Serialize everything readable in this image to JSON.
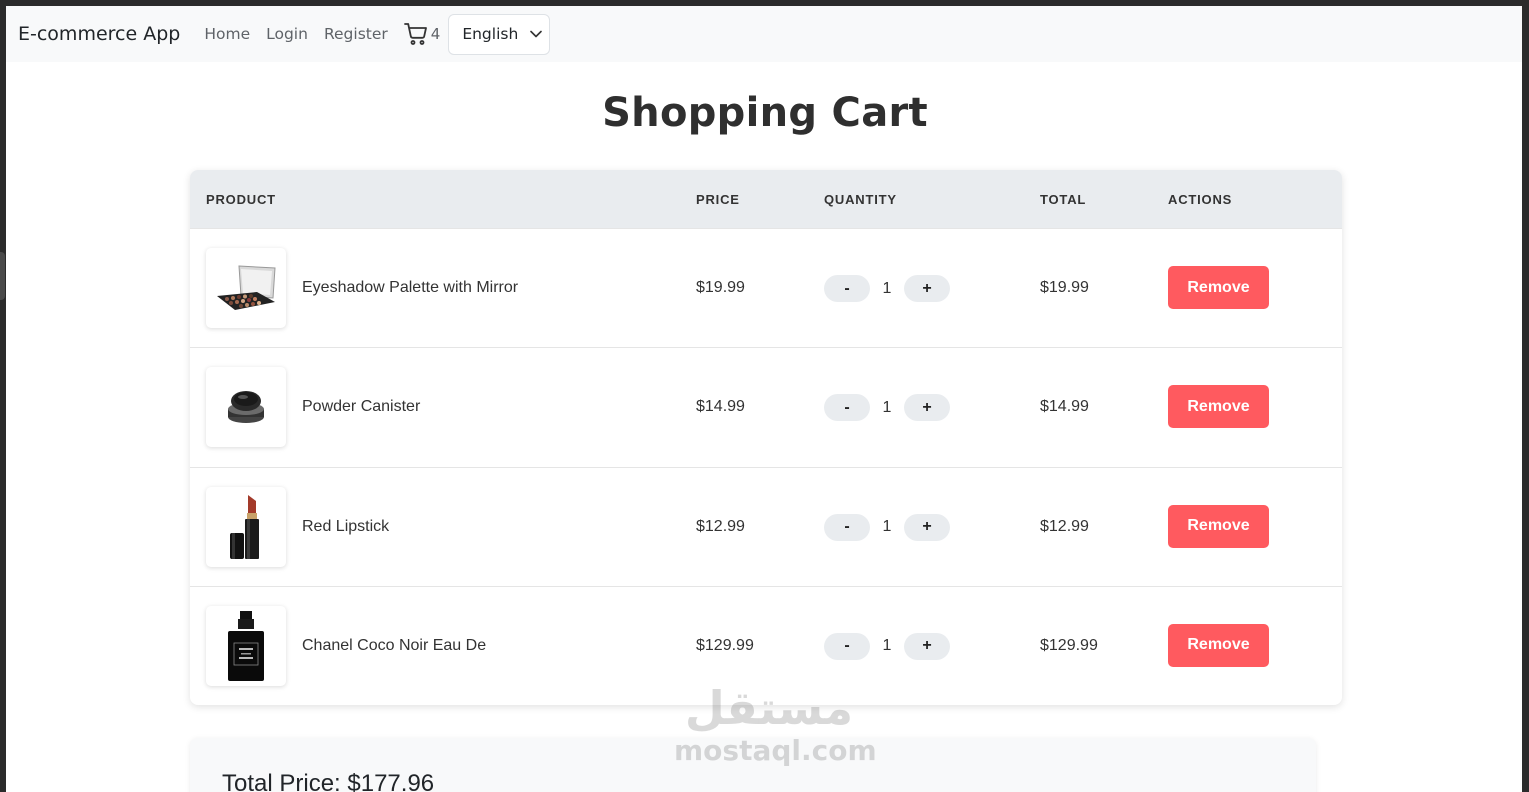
{
  "navbar": {
    "brand": "E-commerce App",
    "links": [
      "Home",
      "Login",
      "Register"
    ],
    "cart_count": "4",
    "language": "English"
  },
  "page": {
    "title": "Shopping Cart"
  },
  "table": {
    "headers": [
      "PRODUCT",
      "PRICE",
      "QUANTITY",
      "TOTAL",
      "ACTIONS"
    ],
    "rows": [
      {
        "name": "Eyeshadow Palette with Mirror",
        "price": "$19.99",
        "quantity": "1",
        "total": "$19.99",
        "action": "Remove",
        "image_icon": "eyeshadow-palette-icon"
      },
      {
        "name": "Powder Canister",
        "price": "$14.99",
        "quantity": "1",
        "total": "$14.99",
        "action": "Remove",
        "image_icon": "powder-canister-icon"
      },
      {
        "name": "Red Lipstick",
        "price": "$12.99",
        "quantity": "1",
        "total": "$12.99",
        "action": "Remove",
        "image_icon": "lipstick-icon"
      },
      {
        "name": "Chanel Coco Noir Eau De",
        "price": "$129.99",
        "quantity": "1",
        "total": "$129.99",
        "action": "Remove",
        "image_icon": "perfume-bottle-icon"
      }
    ],
    "decrement_label": "-",
    "increment_label": "+"
  },
  "summary": {
    "total_price": "Total Price: $177.96"
  },
  "watermark": {
    "arabic": "مستقل",
    "latin": "mostaql.com"
  },
  "colors": {
    "remove_button": "#ff5a5f",
    "header_bg": "#e9ecef",
    "navbar_bg": "#f8f9fa"
  }
}
